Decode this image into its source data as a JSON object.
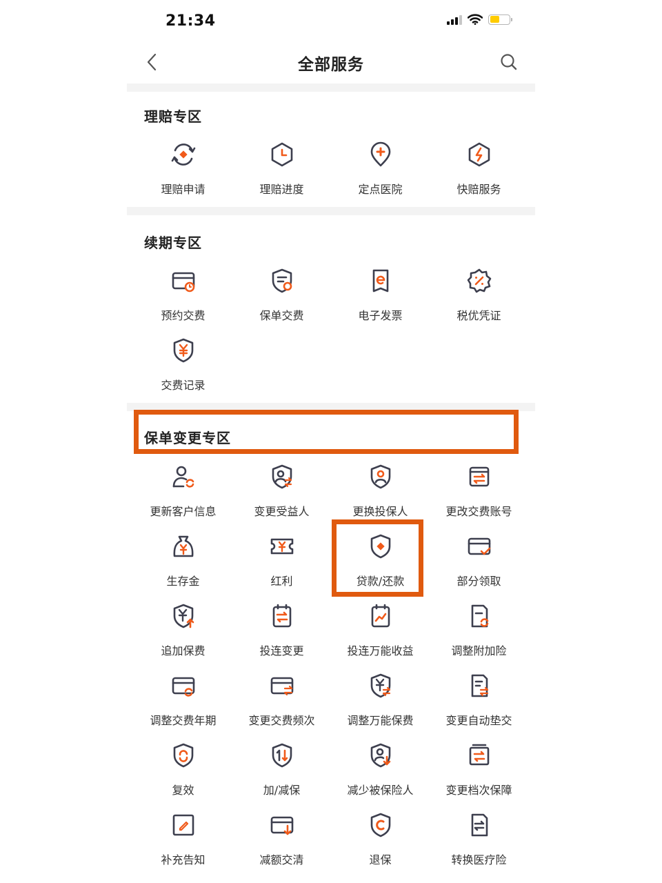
{
  "status_bar": {
    "time": "21:34"
  },
  "nav": {
    "title": "全部服务",
    "back_icon": "chevron-left-icon",
    "search_icon": "search-icon"
  },
  "colors": {
    "accent": "#f05a1a",
    "icon_stroke": "#3d3f4e",
    "highlight": "#e05a0f"
  },
  "sections": [
    {
      "title": "理赔专区",
      "items": [
        {
          "label": "理赔申请",
          "icon": "claim-apply-icon"
        },
        {
          "label": "理赔进度",
          "icon": "claim-progress-icon"
        },
        {
          "label": "定点医院",
          "icon": "hospital-location-icon"
        },
        {
          "label": "快赔服务",
          "icon": "fast-claim-icon"
        }
      ]
    },
    {
      "title": "续期专区",
      "items": [
        {
          "label": "预约交费",
          "icon": "scheduled-payment-icon"
        },
        {
          "label": "保单交费",
          "icon": "policy-payment-icon"
        },
        {
          "label": "电子发票",
          "icon": "e-invoice-icon"
        },
        {
          "label": "税优凭证",
          "icon": "tax-certificate-icon"
        },
        {
          "label": "交费记录",
          "icon": "payment-record-icon"
        }
      ]
    },
    {
      "title": "保单变更专区",
      "items": [
        {
          "label": "更新客户信息",
          "icon": "update-customer-icon"
        },
        {
          "label": "变更受益人",
          "icon": "change-beneficiary-icon"
        },
        {
          "label": "更换投保人",
          "icon": "change-policyholder-icon"
        },
        {
          "label": "更改交费账号",
          "icon": "change-account-icon"
        },
        {
          "label": "生存金",
          "icon": "survival-fund-icon"
        },
        {
          "label": "红利",
          "icon": "dividend-icon"
        },
        {
          "label": "贷款/还款",
          "icon": "loan-repay-icon"
        },
        {
          "label": "部分领取",
          "icon": "partial-withdrawal-icon"
        },
        {
          "label": "追加保费",
          "icon": "add-premium-icon"
        },
        {
          "label": "投连变更",
          "icon": "unit-linked-change-icon"
        },
        {
          "label": "投连万能收益",
          "icon": "universal-yield-icon"
        },
        {
          "label": "调整附加险",
          "icon": "adjust-rider-icon"
        },
        {
          "label": "调整交费年期",
          "icon": "adjust-term-icon"
        },
        {
          "label": "变更交费频次",
          "icon": "change-frequency-icon"
        },
        {
          "label": "调整万能保费",
          "icon": "adjust-universal-premium-icon"
        },
        {
          "label": "变更自动垫交",
          "icon": "auto-advance-icon"
        },
        {
          "label": "复效",
          "icon": "reinstatement-icon"
        },
        {
          "label": "加/减保",
          "icon": "increase-decrease-icon"
        },
        {
          "label": "减少被保险人",
          "icon": "reduce-insured-icon"
        },
        {
          "label": "变更档次保障",
          "icon": "change-tier-icon"
        },
        {
          "label": "补充告知",
          "icon": "supplementary-notice-icon"
        },
        {
          "label": "减额交清",
          "icon": "reduced-paid-up-icon"
        },
        {
          "label": "退保",
          "icon": "surrender-icon"
        },
        {
          "label": "转换医疗险",
          "icon": "convert-medical-icon"
        }
      ]
    }
  ]
}
